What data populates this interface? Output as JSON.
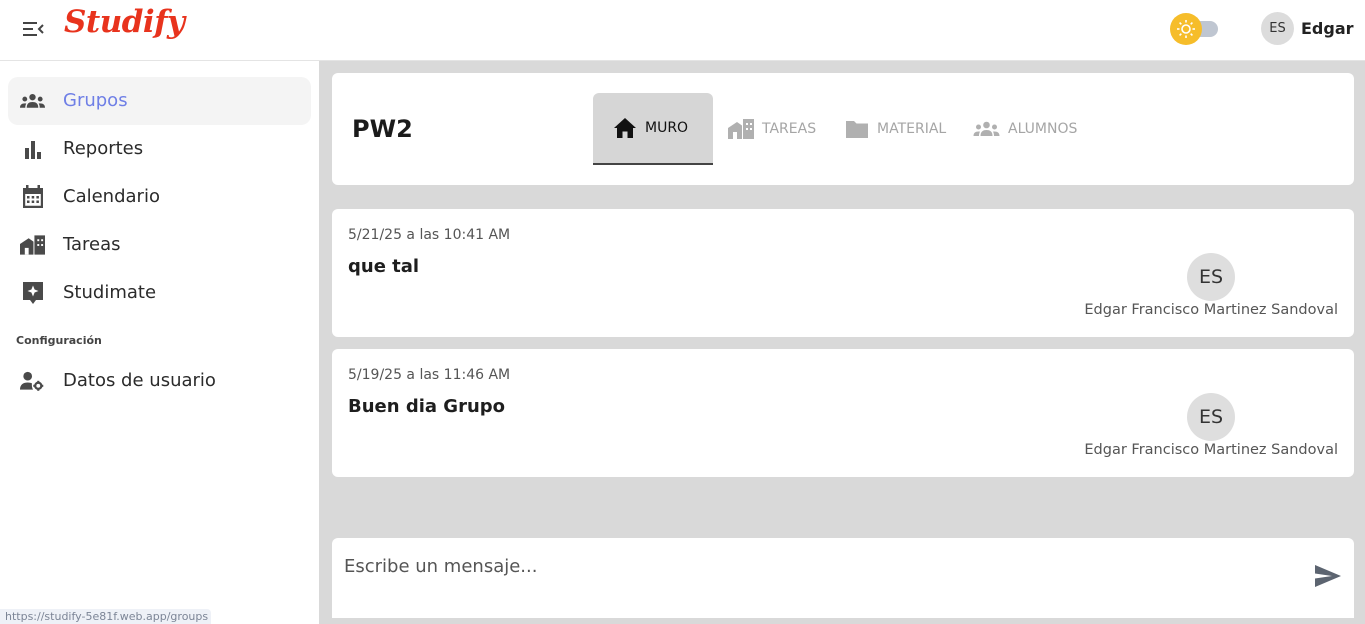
{
  "header": {
    "logo_text": "Studify",
    "user_initials": "ES",
    "user_name": "Edgar"
  },
  "sidebar": {
    "items": [
      {
        "label": "Grupos",
        "icon": "groups-icon",
        "active": true
      },
      {
        "label": "Reportes",
        "icon": "bar-chart-icon",
        "active": false
      },
      {
        "label": "Calendario",
        "icon": "calendar-icon",
        "active": false
      },
      {
        "label": "Tareas",
        "icon": "tasks-icon",
        "active": false
      },
      {
        "label": "Studimate",
        "icon": "sparkle-badge-icon",
        "active": false
      }
    ],
    "section_label": "Configuración",
    "settings_items": [
      {
        "label": "Datos de usuario",
        "icon": "user-settings-icon"
      }
    ]
  },
  "status_url": "https://studify-5e81f.web.app/groups",
  "group": {
    "name": "PW2",
    "tabs": [
      {
        "label": "MURO",
        "icon": "home-icon",
        "active": true
      },
      {
        "label": "TAREAS",
        "icon": "tasks-icon",
        "active": false
      },
      {
        "label": "MATERIAL",
        "icon": "folder-icon",
        "active": false
      },
      {
        "label": "ALUMNOS",
        "icon": "people-icon",
        "active": false
      }
    ]
  },
  "posts": [
    {
      "date": "5/21/25 a las 10:41 AM",
      "text": "que tal",
      "initials": "ES",
      "author": "Edgar Francisco Martinez Sandoval"
    },
    {
      "date": "5/19/25 a las 11:46 AM",
      "text": "Buen dia Grupo",
      "initials": "ES",
      "author": "Edgar Francisco Martinez Sandoval"
    }
  ],
  "composer": {
    "placeholder": "Escribe un mensaje...",
    "value": ""
  },
  "colors": {
    "brand": "#e8331d",
    "active_nav": "#6f7fe6",
    "theme_knob": "#f6bd2a",
    "background": "#d9d9d9"
  }
}
